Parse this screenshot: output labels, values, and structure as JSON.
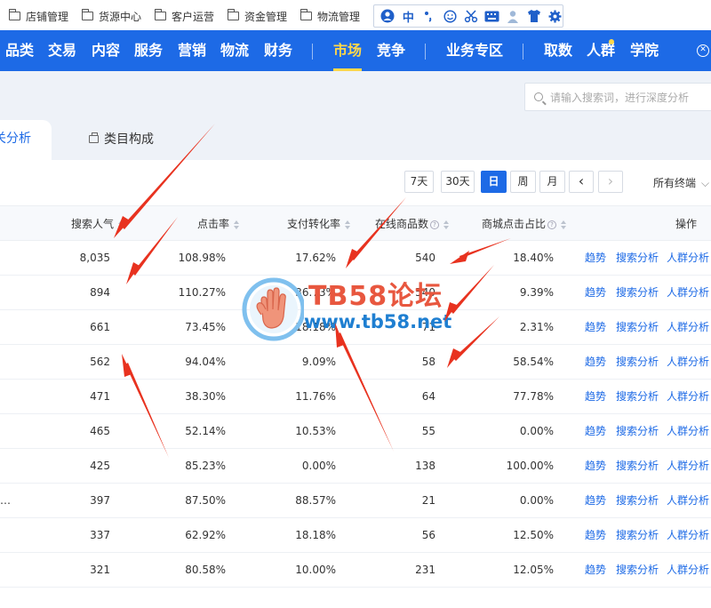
{
  "bookmarks": [
    {
      "label": "店铺管理",
      "icon": "folder-icon"
    },
    {
      "label": "货源中心",
      "icon": "folder-icon"
    },
    {
      "label": "客户运营",
      "icon": "folder-icon"
    },
    {
      "label": "资金管理",
      "icon": "folder-icon"
    },
    {
      "label": "物流管理",
      "icon": "folder-icon"
    }
  ],
  "ime_toolbar": {
    "lang": "中",
    "icons": [
      "ime-logo-icon",
      "punctuation-icon",
      "emoji-icon",
      "scissors-icon",
      "keyboard-icon",
      "user-icon",
      "tshirt-icon",
      "gear-icon"
    ]
  },
  "nav": {
    "items": [
      "品类",
      "交易",
      "内容",
      "服务",
      "营销",
      "物流",
      "财务",
      "市场",
      "竞争",
      "业务专区",
      "取数",
      "人群",
      "学院"
    ],
    "active": "市场",
    "accent": "#1d6ae6",
    "active_color": "#ffd84a"
  },
  "search": {
    "placeholder": "请输入搜索词，进行深度分析"
  },
  "tabs": {
    "active": "关分析",
    "second": "类目构成"
  },
  "date_controls": {
    "buttons": [
      "7天",
      "30天",
      "日",
      "周",
      "月"
    ],
    "selected": "日",
    "prev": "‹",
    "next": "›",
    "terminal": "所有终端"
  },
  "table": {
    "headers": [
      "搜索人气",
      "点击率",
      "支付转化率",
      "在线商品数",
      "商城点击占比",
      "操作"
    ],
    "rows": [
      {
        "lead": "",
        "search": "8,035",
        "ctr": "108.98%",
        "conv": "17.62%",
        "items": "540",
        "mall": "18.40%"
      },
      {
        "lead": "",
        "search": "894",
        "ctr": "110.27%",
        "conv": "36.73%",
        "items": "540",
        "mall": "9.39%"
      },
      {
        "lead": "",
        "search": "661",
        "ctr": "73.45%",
        "conv": "18.18%",
        "items": "71",
        "mall": "2.31%"
      },
      {
        "lead": "",
        "search": "562",
        "ctr": "94.04%",
        "conv": "9.09%",
        "items": "58",
        "mall": "58.54%"
      },
      {
        "lead": "",
        "search": "471",
        "ctr": "38.30%",
        "conv": "11.76%",
        "items": "64",
        "mall": "77.78%"
      },
      {
        "lead": "",
        "search": "465",
        "ctr": "52.14%",
        "conv": "10.53%",
        "items": "55",
        "mall": "0.00%"
      },
      {
        "lead": "",
        "search": "425",
        "ctr": "85.23%",
        "conv": "0.00%",
        "items": "138",
        "mall": "100.00%"
      },
      {
        "lead": "…",
        "search": "397",
        "ctr": "87.50%",
        "conv": "88.57%",
        "items": "21",
        "mall": "0.00%"
      },
      {
        "lead": "",
        "search": "337",
        "ctr": "62.92%",
        "conv": "18.18%",
        "items": "56",
        "mall": "12.50%"
      },
      {
        "lead": "",
        "search": "321",
        "ctr": "80.58%",
        "conv": "10.00%",
        "items": "231",
        "mall": "12.05%"
      }
    ],
    "actions": [
      "趋势",
      "搜索分析",
      "人群分析"
    ]
  },
  "watermark": {
    "title": "TB58论坛",
    "url": "www.tb58.net"
  },
  "annotation_color": "#e8321f"
}
